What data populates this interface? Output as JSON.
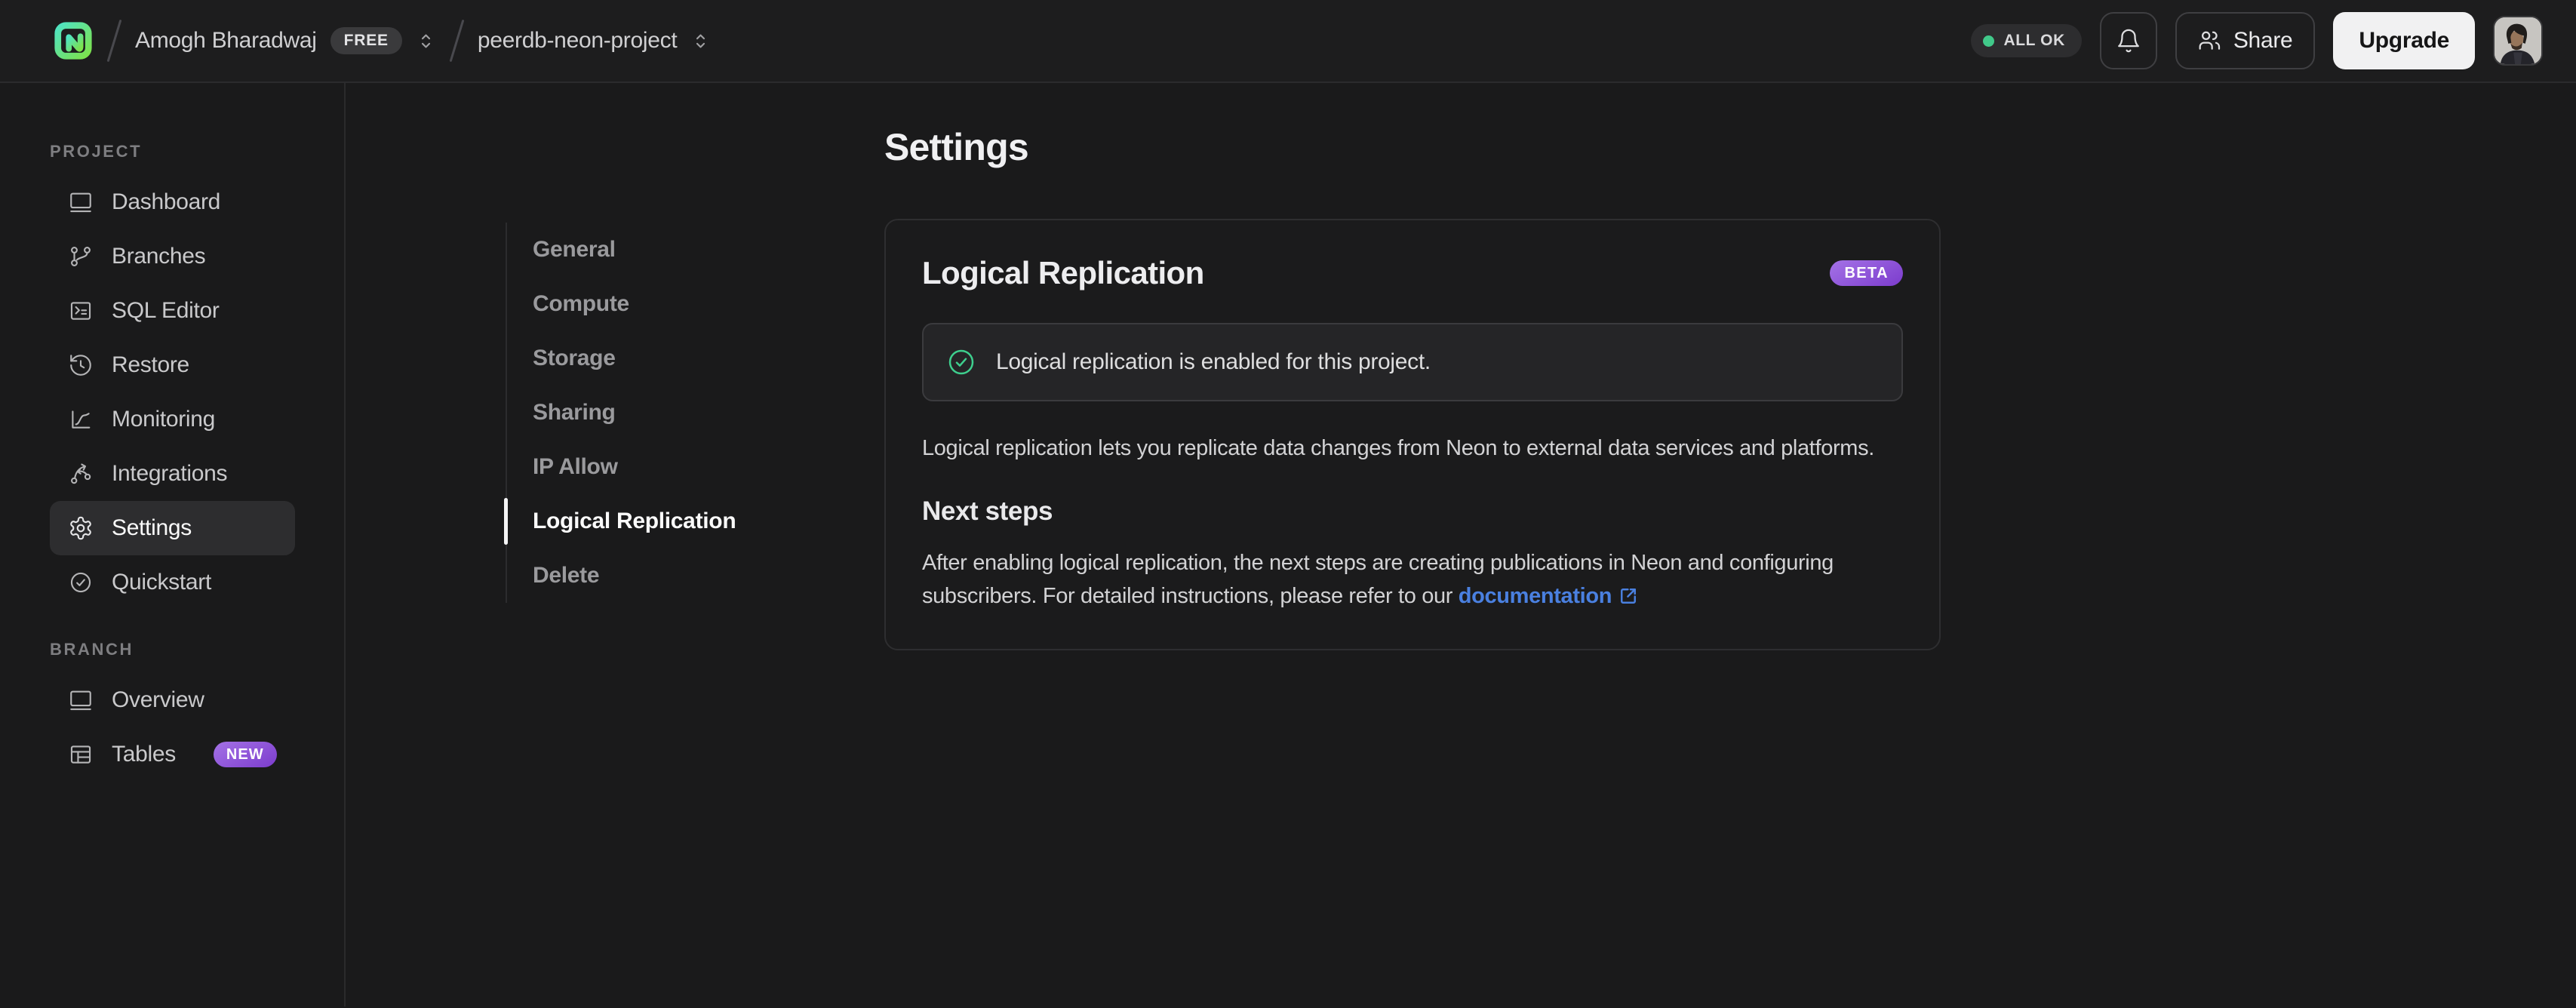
{
  "header": {
    "account": {
      "name": "Amogh Bharadwaj",
      "plan_badge": "FREE"
    },
    "project": {
      "name": "peerdb-neon-project"
    },
    "status": {
      "label": "ALL OK",
      "dot_color": "#41c98a"
    },
    "share_label": "Share",
    "upgrade_label": "Upgrade"
  },
  "sidebar": {
    "sections": [
      {
        "label": "PROJECT",
        "items": [
          {
            "label": "Dashboard"
          },
          {
            "label": "Branches"
          },
          {
            "label": "SQL Editor"
          },
          {
            "label": "Restore"
          },
          {
            "label": "Monitoring"
          },
          {
            "label": "Integrations"
          },
          {
            "label": "Settings",
            "active": true
          },
          {
            "label": "Quickstart"
          }
        ]
      },
      {
        "label": "BRANCH",
        "items": [
          {
            "label": "Overview"
          },
          {
            "label": "Tables",
            "badge": "NEW"
          }
        ]
      }
    ]
  },
  "settings_nav": {
    "items": [
      {
        "label": "General"
      },
      {
        "label": "Compute"
      },
      {
        "label": "Storage"
      },
      {
        "label": "Sharing"
      },
      {
        "label": "IP Allow"
      },
      {
        "label": "Logical Replication",
        "active": true
      },
      {
        "label": "Delete"
      }
    ]
  },
  "main": {
    "page_title": "Settings",
    "card": {
      "title": "Logical Replication",
      "badge": "BETA",
      "alert_text": "Logical replication is enabled for this project.",
      "description": "Logical replication lets you replicate data changes from Neon to external data services and platforms.",
      "next_steps_heading": "Next steps",
      "next_steps_text": "After enabling logical replication, the next steps are creating publications in Neon and configuring subscribers. For detailed instructions, please refer to our ",
      "doc_link_label": "documentation"
    }
  },
  "colors": {
    "accent_green": "#3ecf8e",
    "status_dot_green": "#41c98a",
    "badge_purple_start": "#a472e6",
    "badge_purple_end": "#7c3ccd",
    "link_blue": "#4a80e0",
    "logo_gradient_start": "#4fe3c2",
    "logo_gradient_end": "#7de24b"
  }
}
